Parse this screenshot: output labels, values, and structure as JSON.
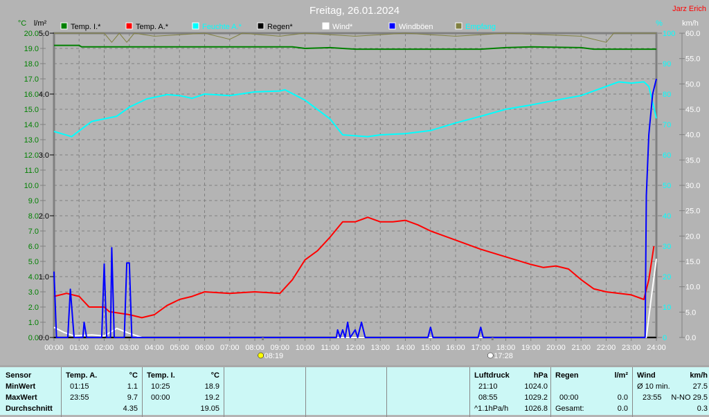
{
  "title": "Freitag, 26.01.2024",
  "author": "Jarz Erich",
  "chart_data": {
    "type": "line",
    "title": "Freitag, 26.01.2024",
    "x_unit": "hours",
    "xlim": [
      0,
      24
    ],
    "x_ticks": [
      "00:00",
      "01:00",
      "02:00",
      "03:00",
      "04:00",
      "05:00",
      "06:00",
      "07:00",
      "08:00",
      "09:00",
      "10:00",
      "11:00",
      "12:00",
      "13:00",
      "14:00",
      "15:00",
      "16:00",
      "17:00",
      "18:00",
      "19:00",
      "20:00",
      "21:00",
      "22:00",
      "23:00",
      "24:00"
    ],
    "axes": {
      "temp": {
        "label": "°C",
        "range": [
          0,
          20
        ],
        "ticks": [
          "0.0",
          "1.0",
          "2.0",
          "3.0",
          "4.0",
          "5.0",
          "6.0",
          "7.0",
          "8.0",
          "9.0",
          "10.0",
          "11.0",
          "12.0",
          "13.0",
          "14.0",
          "15.0",
          "16.0",
          "17.0",
          "18.0",
          "19.0",
          "20.0"
        ],
        "color": "#008000"
      },
      "rain": {
        "label": "l/m²",
        "range": [
          0,
          5
        ],
        "ticks": [
          "0.0",
          "1.0",
          "2.0",
          "3.0",
          "4.0",
          "5.0"
        ],
        "color": "#000000"
      },
      "humidity": {
        "label": "%",
        "range": [
          0,
          100
        ],
        "ticks": [
          "0",
          "10",
          "20",
          "30",
          "40",
          "50",
          "60",
          "70",
          "80",
          "90",
          "100"
        ],
        "color": "#00ffff"
      },
      "wind": {
        "label": "km/h",
        "range": [
          0,
          60
        ],
        "ticks": [
          "0.0",
          "5.0",
          "10.0",
          "15.0",
          "20.0",
          "25.0",
          "30.0",
          "35.0",
          "40.0",
          "45.0",
          "50.0",
          "55.0",
          "60.0"
        ],
        "color": "#ffffff"
      }
    },
    "legend": [
      {
        "name": "Temp. I.*",
        "color": "#008000",
        "text_color": "#000000"
      },
      {
        "name": "Temp. A.*",
        "color": "#ff0000",
        "text_color": "#000000"
      },
      {
        "name": "Feuchte A.*",
        "color": "#00ffff",
        "text_color": "#00ffff"
      },
      {
        "name": "Regen*",
        "color": "#000000",
        "text_color": "#000000"
      },
      {
        "name": "Wind*",
        "color": "#ffffff",
        "text_color": "#ffffff"
      },
      {
        "name": "Windböen",
        "color": "#0000ff",
        "text_color": "#ffffff"
      },
      {
        "name": "Empfang",
        "color": "#808040",
        "text_color": "#00ffff"
      }
    ],
    "series": [
      {
        "name": "Temp. I.*",
        "axis": "temp",
        "color": "#008000",
        "points": [
          [
            0,
            19.2
          ],
          [
            1,
            19.2
          ],
          [
            1.1,
            19.1
          ],
          [
            9.5,
            19.1
          ],
          [
            10,
            19.0
          ],
          [
            11,
            19.05
          ],
          [
            12,
            18.95
          ],
          [
            17,
            18.95
          ],
          [
            18,
            19.05
          ],
          [
            19,
            19.1
          ],
          [
            21,
            19.05
          ],
          [
            21.5,
            18.95
          ],
          [
            24,
            18.95
          ]
        ]
      },
      {
        "name": "Feuchte A.*",
        "axis": "humidity",
        "color": "#00ffff",
        "points": [
          [
            0,
            67.7
          ],
          [
            0.7,
            66
          ],
          [
            1.5,
            71
          ],
          [
            2.5,
            72.7
          ],
          [
            3,
            75.7
          ],
          [
            3.7,
            78.4
          ],
          [
            4.5,
            79.8
          ],
          [
            5,
            79.5
          ],
          [
            5.5,
            78.6
          ],
          [
            6,
            80
          ],
          [
            7,
            79.5
          ],
          [
            8,
            80.7
          ],
          [
            9,
            81
          ],
          [
            9.2,
            81.4
          ],
          [
            10,
            78
          ],
          [
            11,
            71.8
          ],
          [
            11.5,
            66.6
          ],
          [
            12.5,
            66
          ],
          [
            13,
            66.6
          ],
          [
            14,
            67
          ],
          [
            15,
            68
          ],
          [
            16,
            70.5
          ],
          [
            17,
            72.7
          ],
          [
            18,
            75
          ],
          [
            19,
            76.4
          ],
          [
            20,
            78
          ],
          [
            21,
            79.5
          ],
          [
            22,
            82.5
          ],
          [
            22.5,
            84
          ],
          [
            23,
            83.6
          ],
          [
            23.5,
            84
          ],
          [
            23.7,
            82.5
          ],
          [
            24,
            72
          ]
        ]
      },
      {
        "name": "Temp. A.*",
        "axis": "temp",
        "color": "#ff0000",
        "points": [
          [
            0,
            2.7
          ],
          [
            0.5,
            2.9
          ],
          [
            1,
            2.7
          ],
          [
            1.4,
            2.0
          ],
          [
            2,
            2.0
          ],
          [
            2.2,
            1.7
          ],
          [
            3,
            1.5
          ],
          [
            3.5,
            1.3
          ],
          [
            4,
            1.5
          ],
          [
            4.5,
            2.1
          ],
          [
            5,
            2.5
          ],
          [
            5.5,
            2.7
          ],
          [
            6,
            3.0
          ],
          [
            7,
            2.9
          ],
          [
            8,
            3.0
          ],
          [
            9,
            2.9
          ],
          [
            9.5,
            3.8
          ],
          [
            10,
            5.1
          ],
          [
            10.5,
            5.7
          ],
          [
            11,
            6.6
          ],
          [
            11.5,
            7.6
          ],
          [
            12,
            7.6
          ],
          [
            12.5,
            7.9
          ],
          [
            13,
            7.6
          ],
          [
            13.5,
            7.6
          ],
          [
            14,
            7.7
          ],
          [
            14.5,
            7.4
          ],
          [
            15,
            7.0
          ],
          [
            16,
            6.4
          ],
          [
            17,
            5.8
          ],
          [
            18,
            5.3
          ],
          [
            19,
            4.8
          ],
          [
            19.5,
            4.6
          ],
          [
            20,
            4.7
          ],
          [
            20.5,
            4.5
          ],
          [
            21,
            3.8
          ],
          [
            21.5,
            3.2
          ],
          [
            22,
            3.0
          ],
          [
            23,
            2.8
          ],
          [
            23.5,
            2.5
          ],
          [
            23.7,
            3.8
          ],
          [
            23.9,
            6.0
          ]
        ]
      },
      {
        "name": "Regen*",
        "axis": "rain",
        "color": "#000000",
        "points": [
          [
            0,
            0
          ],
          [
            24,
            0
          ]
        ]
      },
      {
        "name": "Wind*",
        "axis": "wind",
        "color": "#ffffff",
        "points": [
          [
            0,
            2
          ],
          [
            0.4,
            1
          ],
          [
            0.8,
            0.3
          ],
          [
            1.5,
            0.5
          ],
          [
            2,
            0.3
          ],
          [
            2.5,
            1.8
          ],
          [
            3,
            0.8
          ],
          [
            3.5,
            0
          ],
          [
            23.6,
            0
          ],
          [
            23.8,
            8
          ],
          [
            24,
            15.5
          ]
        ]
      },
      {
        "name": "Windböen",
        "axis": "wind",
        "color": "#0000ff",
        "points": [
          [
            0,
            13
          ],
          [
            0.1,
            0
          ],
          [
            0.55,
            0
          ],
          [
            0.65,
            9.5
          ],
          [
            0.8,
            0
          ],
          [
            1.15,
            0
          ],
          [
            1.2,
            3
          ],
          [
            1.3,
            0
          ],
          [
            1.9,
            0
          ],
          [
            2,
            14.5
          ],
          [
            2.1,
            0
          ],
          [
            2.25,
            0
          ],
          [
            2.3,
            17.7
          ],
          [
            2.4,
            0
          ],
          [
            2.8,
            0
          ],
          [
            2.9,
            14.7
          ],
          [
            3.0,
            14.7
          ],
          [
            3.1,
            0
          ],
          [
            11.25,
            0
          ],
          [
            11.3,
            1.5
          ],
          [
            11.4,
            0
          ],
          [
            11.5,
            1.5
          ],
          [
            11.6,
            0
          ],
          [
            11.7,
            3
          ],
          [
            11.8,
            0
          ],
          [
            12,
            1.5
          ],
          [
            12.1,
            0
          ],
          [
            12.25,
            3
          ],
          [
            12.4,
            0
          ],
          [
            14.9,
            0
          ],
          [
            15,
            2
          ],
          [
            15.1,
            0
          ],
          [
            16.9,
            0
          ],
          [
            17,
            2
          ],
          [
            17.1,
            0
          ],
          [
            23.55,
            0
          ],
          [
            23.6,
            28
          ],
          [
            23.7,
            40
          ],
          [
            23.85,
            48
          ],
          [
            24,
            51
          ]
        ]
      },
      {
        "name": "Empfang",
        "axis": "humidity",
        "color": "#808040",
        "points": [
          [
            0,
            100
          ],
          [
            2,
            100
          ],
          [
            2.3,
            97
          ],
          [
            2.6,
            100
          ],
          [
            2.9,
            97
          ],
          [
            3.2,
            100
          ],
          [
            4,
            99
          ],
          [
            6,
            100
          ],
          [
            7,
            98
          ],
          [
            7.5,
            100
          ],
          [
            9,
            99
          ],
          [
            10,
            100
          ],
          [
            12,
            99
          ],
          [
            14,
            100
          ],
          [
            16,
            99
          ],
          [
            18,
            100
          ],
          [
            21,
            99
          ],
          [
            22,
            97
          ],
          [
            22.3,
            100
          ],
          [
            24,
            100
          ]
        ]
      }
    ],
    "markers": [
      {
        "label": "08:19",
        "type": "sunrise",
        "x": 8.32
      },
      {
        "label": "17:28",
        "type": "sunset",
        "x": 17.47
      }
    ]
  },
  "table": {
    "row_labels": [
      "Sensor",
      "MinWert",
      "MaxWert",
      "Durchschnitt"
    ],
    "temp_a": {
      "header": "Temp. A.",
      "unit": "°C",
      "min_time": "01:15",
      "min": "1.1",
      "max_time": "23:55",
      "max": "9.7",
      "avg": "4.35"
    },
    "temp_i": {
      "header": "Temp. I.",
      "unit": "°C",
      "min_time": "10:25",
      "min": "18.9",
      "max_time": "00:00",
      "max": "19.2",
      "avg": "19.05"
    },
    "pressure": {
      "header": "Luftdruck",
      "unit": "hPa",
      "min_time": "21:10",
      "min": "1024.0",
      "max_time": "08:55",
      "max": "1029.2",
      "trend": "^1.1hPa/h",
      "avg": "1026.8"
    },
    "rain": {
      "header": "Regen",
      "unit": "l/m²",
      "max_time": "00:00",
      "max": "0.0",
      "total_label": "Gesamt:",
      "total": "0.0"
    },
    "wind": {
      "header": "Wind",
      "unit": "km/h",
      "avg_label": "Ø 10 min.",
      "avg": "27.5",
      "max_time": "23:55",
      "max": "N-NO 29.5",
      "mean": "0.3"
    }
  }
}
